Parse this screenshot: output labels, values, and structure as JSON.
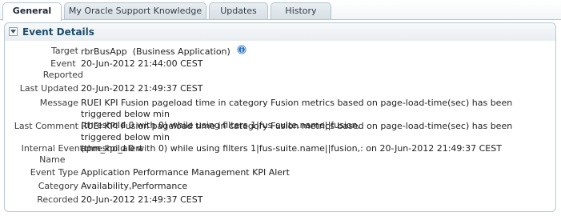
{
  "tabs": [
    {
      "label": "General",
      "active": true
    },
    {
      "label": "My Oracle Support Knowledge",
      "active": false
    },
    {
      "label": "Updates",
      "active": false
    },
    {
      "label": "History",
      "active": false
    }
  ],
  "panel": {
    "title": "Event Details",
    "collapse_icon": "chevron-down-icon",
    "fields": {
      "target": {
        "label": "Target",
        "value": "rbrBusApp  (Business Application)",
        "icon": "info-icon"
      },
      "event_reported": {
        "label_line1": "Event",
        "label_line2": "Reported",
        "value": "20-Jun-2012 21:44:00 CEST"
      },
      "last_updated": {
        "label": "Last Updated",
        "value": "20-Jun-2012 21:49:37 CEST"
      },
      "message": {
        "label": "Message",
        "value_line1": "RUEI KPI Fusion pageload time in category Fusion metrics based on page-load-time(sec) has been triggered below min",
        "value_line2": "(threshold 0 with 0) while using filters 1|fus-suite.name||fusion,"
      },
      "last_comment": {
        "label": "Last Comment",
        "value_line1": "RUEI KPI Fusion pageload time in category Fusion metrics based on page-load-time(sec) has been triggered below min",
        "value_line2": "(threshold 0 with 0) while using filters 1|fus-suite.name||fusion,: on 20-Jun-2012 21:49:37 CEST"
      },
      "internal_event_name": {
        "label_line1": "Internal Event",
        "label_line2": "Name",
        "value": "apm_kpi_alert"
      },
      "event_type": {
        "label": "Event Type",
        "value": "Application Performance Management KPI Alert"
      },
      "category": {
        "label": "Category",
        "value": "Availability,Performance"
      },
      "recorded": {
        "label": "Recorded",
        "value": "20-Jun-2012 21:49:37 CEST"
      }
    }
  },
  "colors": {
    "panel_title": "#1c4d6b",
    "border": "#b8c8d3",
    "info_icon": "#2e74c8"
  }
}
